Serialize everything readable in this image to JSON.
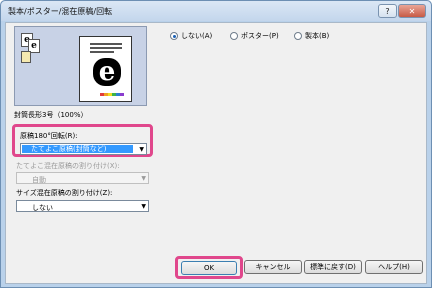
{
  "window": {
    "title": "製本/ポスター/混在原稿/回転",
    "help_glyph": "?",
    "close_glyph": "✕"
  },
  "preview": {
    "mini_letters": [
      "e",
      "e"
    ],
    "page_letter": "e",
    "caption": "封筒長形3号（100%）"
  },
  "rotate": {
    "label": "原稿180°回転(R):",
    "value": "たてよこ原稿(封筒など)"
  },
  "mixed_paper": {
    "label": "たてよこ混在原稿の割り付け(X):",
    "value": "自動",
    "enabled": false
  },
  "size_mixed": {
    "label": "サイズ混在原稿の割り付け(Z):",
    "value": "しない"
  },
  "layout_mode": {
    "options": [
      {
        "label": "しない(A)",
        "selected": true
      },
      {
        "label": "ポスター(P)",
        "selected": false
      },
      {
        "label": "製本(B)",
        "selected": false
      }
    ]
  },
  "buttons": {
    "ok": "OK",
    "cancel": "キャンセル",
    "defaults": "標準に戻す(D)",
    "help": "ヘルプ(H)"
  },
  "colors": {
    "highlight_frame": "#e0478c",
    "selection": "#3399ff",
    "preview_bg": "#c8d2e6"
  }
}
